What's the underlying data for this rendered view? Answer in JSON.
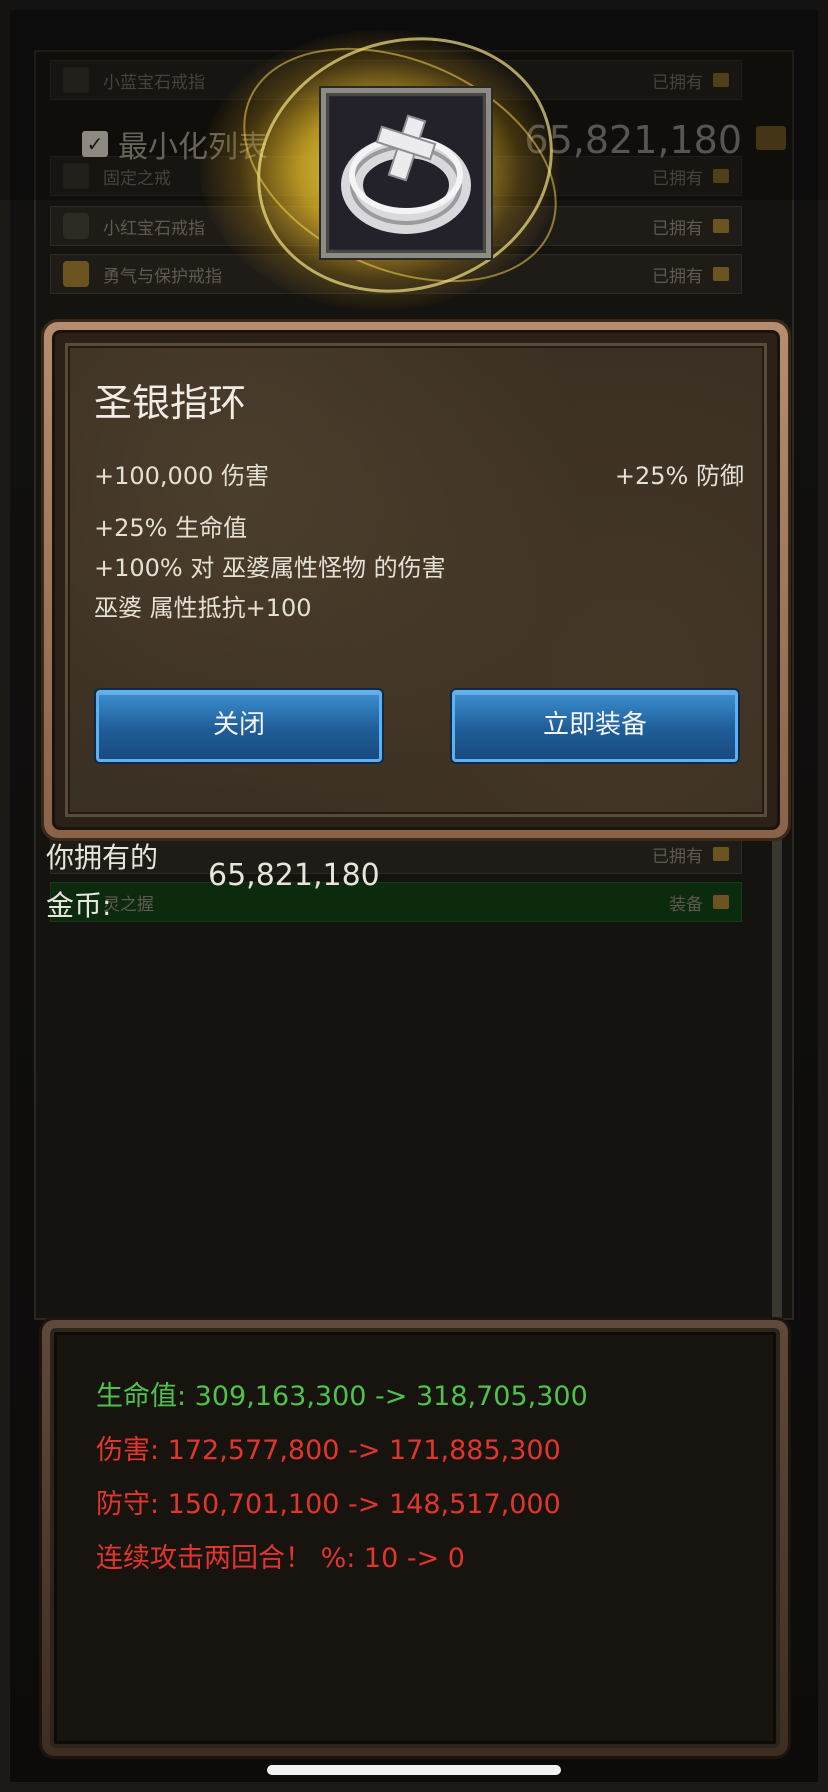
{
  "background_list": {
    "minimize_label": "最小化列表",
    "gold_total": "65,821,180",
    "rows": [
      {
        "name": "小蓝宝石戒指",
        "status": "已拥有"
      },
      {
        "name": "",
        "status": ""
      },
      {
        "name": "固定之戒",
        "status": "已拥有"
      },
      {
        "name": "小红宝石戒指",
        "status": "已拥有"
      },
      {
        "name": "勇气与保护戒指",
        "status": "已拥有"
      },
      {
        "name": "",
        "status": "已拥有"
      },
      {
        "name": "灵之握",
        "status": "装备"
      }
    ]
  },
  "item": {
    "icon": "silver-cross-ring-icon",
    "title": "圣银指环",
    "damage": "+100,000 伤害",
    "defense": "+25% 防御",
    "hp": "+25% 生命值",
    "vs_witch": "+100% 对 巫婆属性怪物 的伤害",
    "resist": "巫婆 属性抵抗+100"
  },
  "buttons": {
    "close": "关闭",
    "equip": "立即装备"
  },
  "gold": {
    "label_line1": "你拥有的",
    "label_line2": "金币:",
    "value": "65,821,180"
  },
  "comparison": {
    "hp": "生命值: 309,163,300 -> 318,705,300",
    "damage": "伤害: 172,577,800 -> 171,885,300",
    "defense": "防守: 150,701,100 -> 148,517,000",
    "double_attack": "连续攻击两回合！ %: 10 -> 0"
  },
  "colors": {
    "increase": "#4fc24a",
    "decrease": "#e2352c",
    "button": "#2a78bd"
  }
}
